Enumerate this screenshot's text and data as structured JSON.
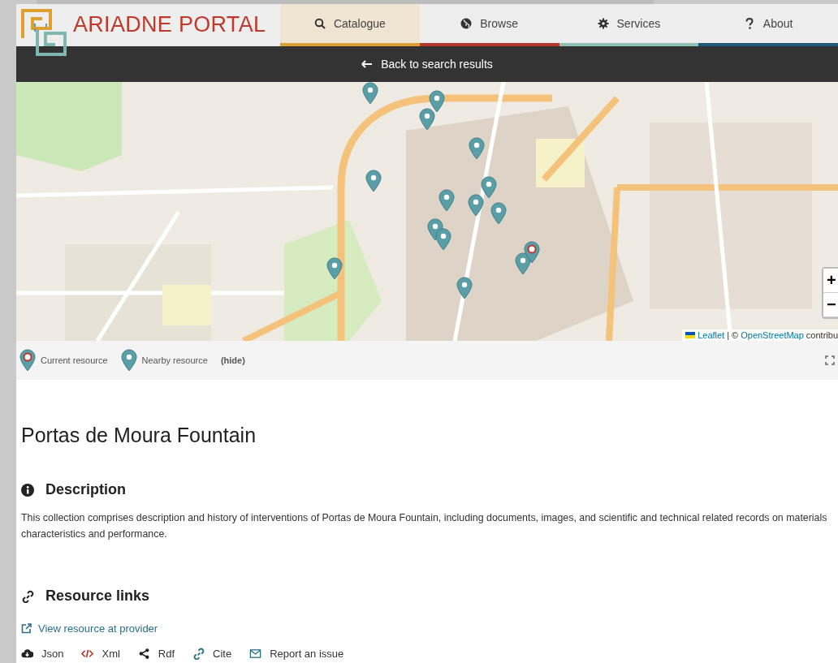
{
  "header": {
    "logo_text": "ARIADNE PORTAL",
    "nav": [
      {
        "label": "Catalogue",
        "selected": true,
        "color": "#e0a030"
      },
      {
        "label": "Browse",
        "selected": false,
        "color": "#b8352a"
      },
      {
        "label": "Services",
        "selected": false,
        "color": "#8fc1b5"
      },
      {
        "label": "About",
        "selected": false,
        "color": "#1f5a7a"
      }
    ]
  },
  "back_bar": {
    "label": "Back to search results"
  },
  "map": {
    "markers": [
      {
        "kind": "nearby"
      },
      {
        "kind": "nearby"
      },
      {
        "kind": "nearby"
      },
      {
        "kind": "nearby"
      },
      {
        "kind": "nearby"
      },
      {
        "kind": "nearby"
      },
      {
        "kind": "nearby"
      },
      {
        "kind": "nearby"
      },
      {
        "kind": "nearby"
      },
      {
        "kind": "nearby"
      },
      {
        "kind": "nearby"
      },
      {
        "kind": "nearby"
      },
      {
        "kind": "nearby"
      },
      {
        "kind": "nearby"
      },
      {
        "kind": "current"
      }
    ],
    "zoom_in": "+",
    "zoom_out": "−",
    "attribution": [
      {
        "text": "Leaflet",
        "link": true
      },
      {
        "text": "| ©",
        "link": false
      },
      {
        "text": "OpenStreetMap",
        "link": true
      },
      {
        "text": "contribu",
        "link": false
      }
    ]
  },
  "legend": {
    "items": [
      {
        "label": "Current resource",
        "kind": "current"
      },
      {
        "label": "Nearby resource",
        "kind": "nearby"
      }
    ],
    "toggle": "(hide)"
  },
  "title": "Portas de Moura Fountain",
  "description": {
    "heading": "Description",
    "text": "This collection comprises description and history of interventions of Portas de Moura Fountain, including documents, images, and scientific and technical related records on materials characteristics and performance."
  },
  "resource_links": {
    "heading": "Resource links",
    "provider_link": "View resource at provider",
    "links": [
      "Json",
      "Xml",
      "Rdf",
      "Cite",
      "Report an issue"
    ]
  }
}
